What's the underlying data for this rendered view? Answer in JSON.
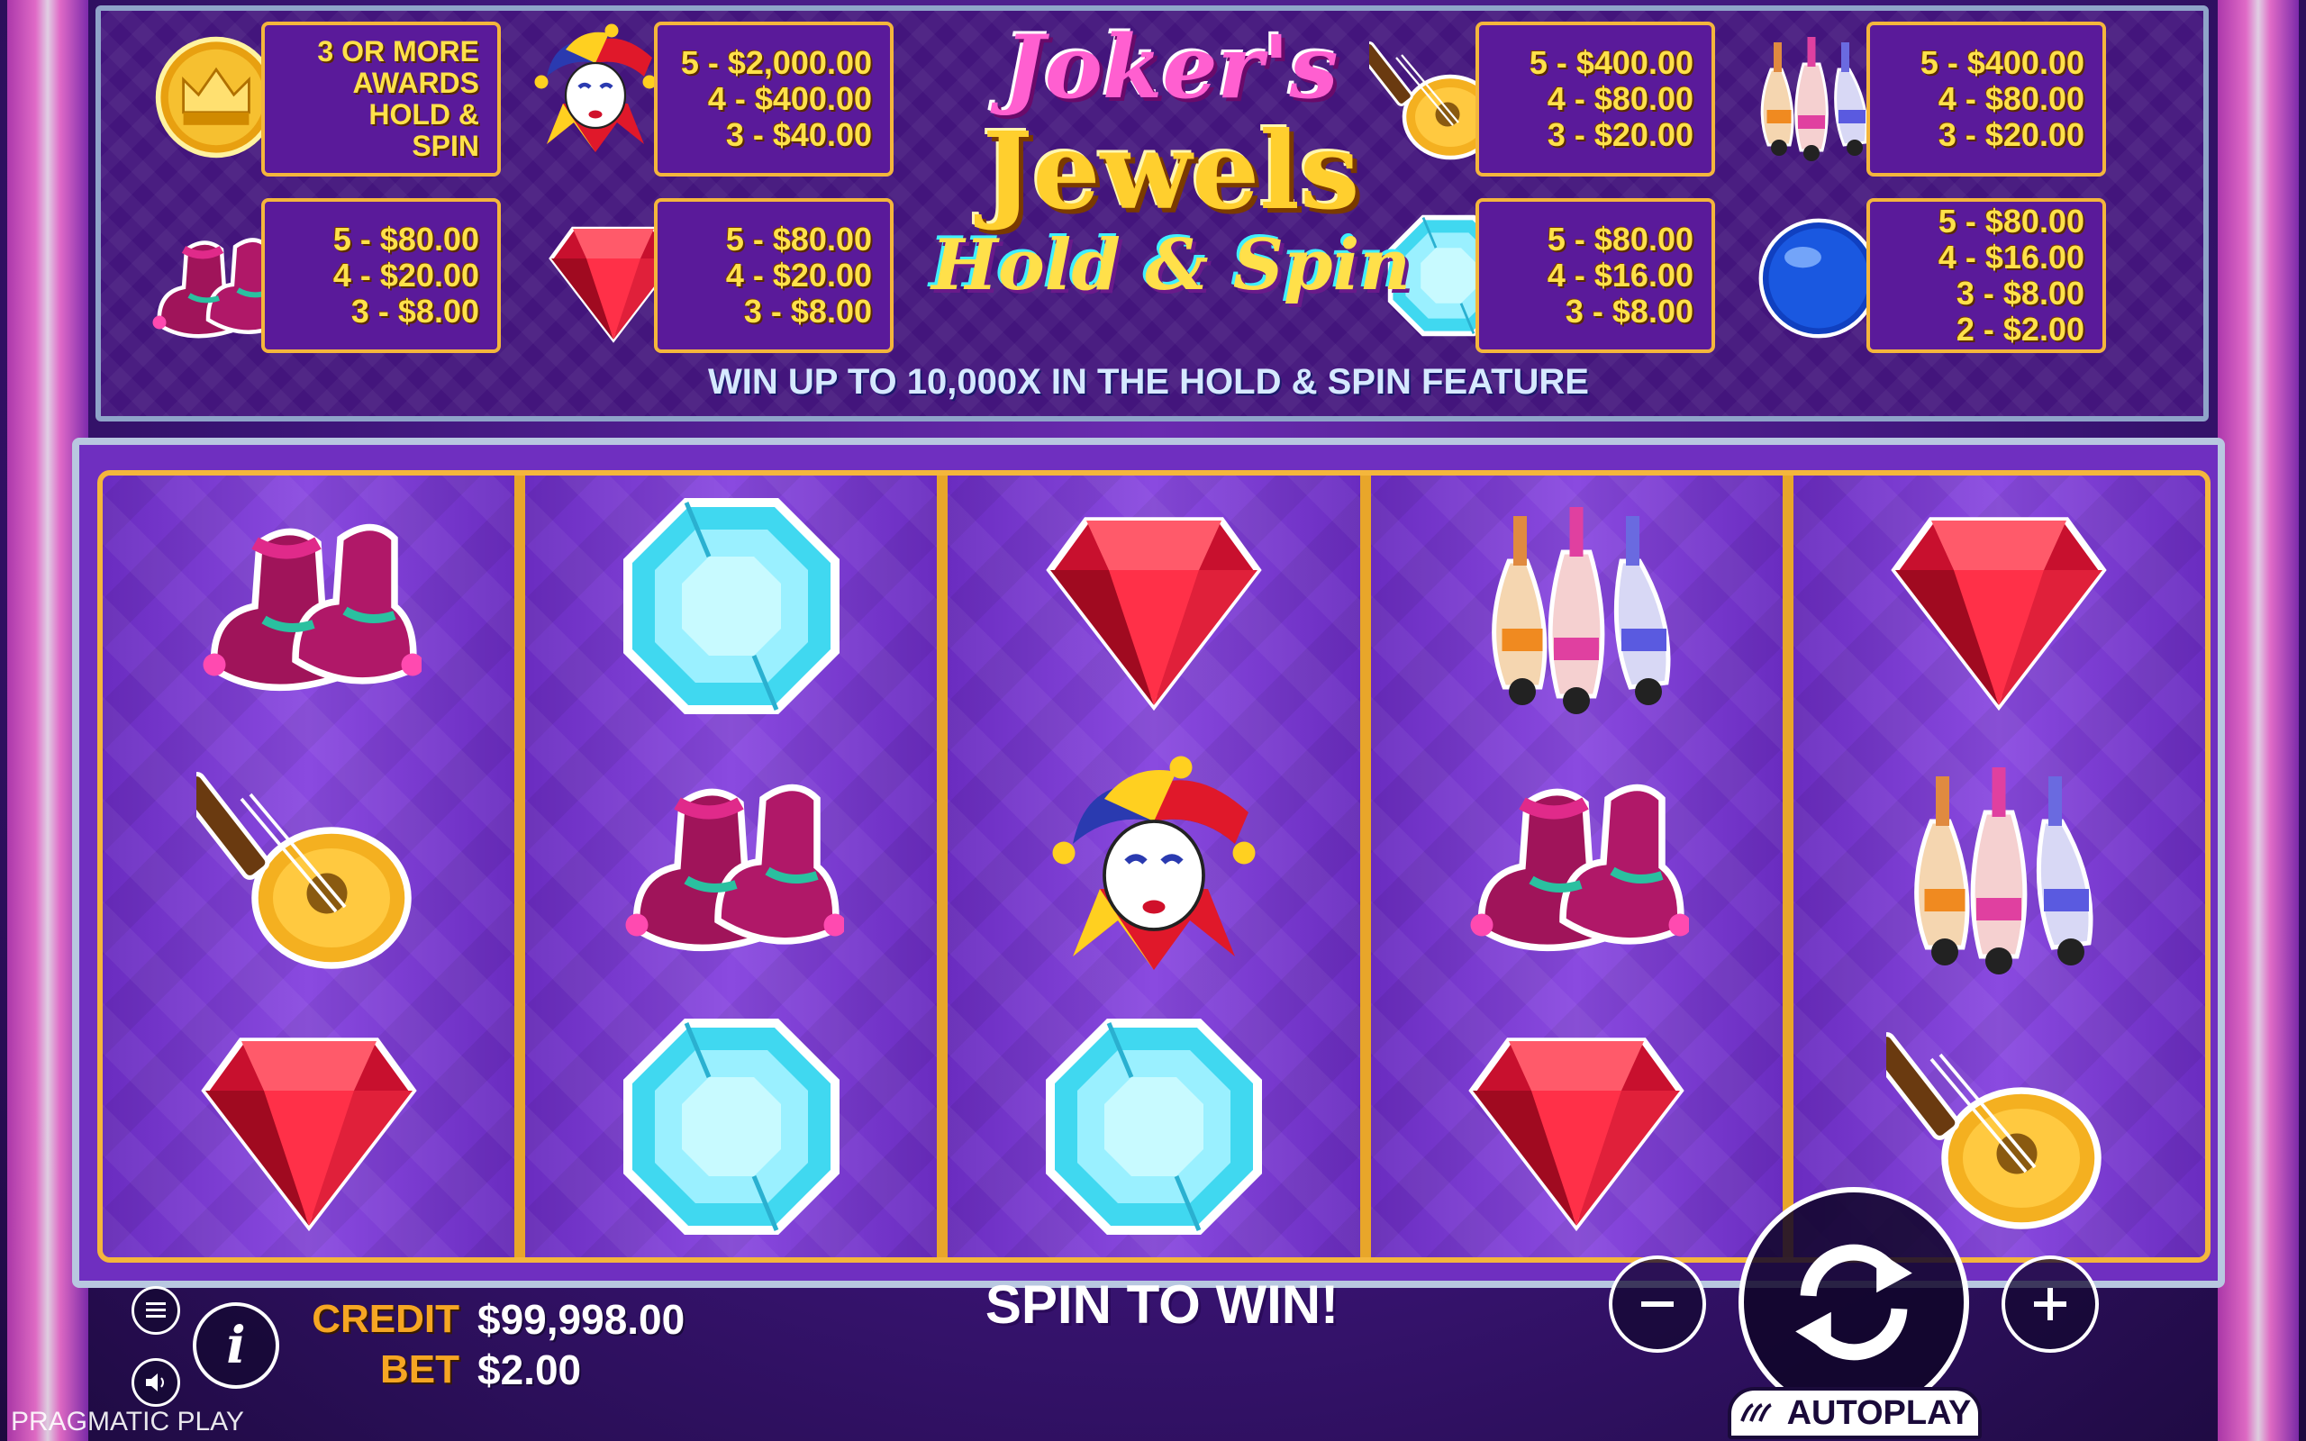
{
  "paytable": {
    "crown": [
      "3 OR MORE",
      "AWARDS",
      "HOLD &",
      "SPIN"
    ],
    "joker": [
      "5 - $2,000.00",
      "4 - $400.00",
      "3 - $40.00"
    ],
    "lute": [
      "5 - $400.00",
      "4 - $80.00",
      "3 - $20.00"
    ],
    "pins": [
      "5 - $400.00",
      "4 - $80.00",
      "3 - $20.00"
    ],
    "shoes": [
      "5 - $80.00",
      "4 - $20.00",
      "3 - $8.00"
    ],
    "ruby": [
      "5 - $80.00",
      "4 - $20.00",
      "3 - $8.00"
    ],
    "diamond": [
      "5 - $80.00",
      "4 - $16.00",
      "3 - $8.00"
    ],
    "ball": [
      "5 - $80.00",
      "4 - $16.00",
      "3 - $8.00",
      "2 - $2.00"
    ],
    "banner": "WIN UP TO 10,000X IN THE HOLD & SPIN FEATURE"
  },
  "logo": {
    "line1": "Joker's",
    "line2": "Jewels",
    "line3": "Hold & Spin"
  },
  "reels": [
    [
      "shoes",
      "lute",
      "ruby"
    ],
    [
      "diamond",
      "shoes",
      "diamond"
    ],
    [
      "ruby",
      "joker",
      "diamond"
    ],
    [
      "pins",
      "shoes",
      "ruby"
    ],
    [
      "ruby",
      "pins",
      "lute"
    ]
  ],
  "status": {
    "credit_label": "CREDIT",
    "credit_value": "$99,998.00",
    "bet_label": "BET",
    "bet_value": "$2.00",
    "message": "SPIN TO WIN!",
    "autoplay_label": "AUTOPLAY",
    "brand": "PRAGMATIC PLAY"
  },
  "controls": {
    "menu_icon": "menu-icon",
    "info_icon": "info-icon",
    "sound_icon": "speaker-icon",
    "minus_icon": "minus-icon",
    "plus_icon": "plus-icon",
    "spin_icon": "spin-arrows-icon"
  },
  "colors": {
    "gold": "#f4b63c",
    "purple": "#5a1a9a",
    "label_orange": "#f6a623"
  }
}
